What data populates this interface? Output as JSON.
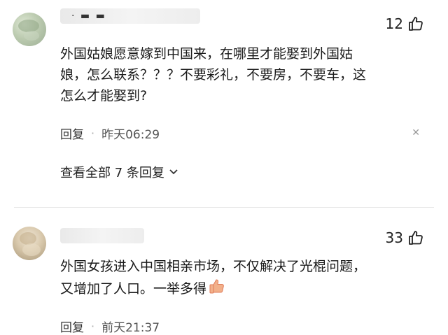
{
  "comments": [
    {
      "likes": "12",
      "text_lines": [
        "外国姑娘愿意嫁到中国来，在哪里才能娶到外国姑",
        "娘，怎么联系？？？不要彩礼，不要房，不要车，这",
        "怎么才能娶到?"
      ],
      "reply_label": "回复",
      "time": "昨天06:29",
      "view_replies": "查看全部 7 条回复"
    },
    {
      "likes": "33",
      "text_lines": [
        "外国女孩进入中国相亲市场，不仅解决了光棍问题，",
        "又增加了人口。一举多得"
      ],
      "reply_label": "回复",
      "time": "前天21:37"
    }
  ],
  "icons": {
    "like": "thumbs-up-outline-icon",
    "emoji": "thumbs-up-emoji-icon",
    "more": "close-x-icon",
    "expand": "chevron-down-icon"
  },
  "colors": {
    "text": "#1a1a1a",
    "meta": "#555555",
    "emoji_skin": "#f2b08a"
  }
}
